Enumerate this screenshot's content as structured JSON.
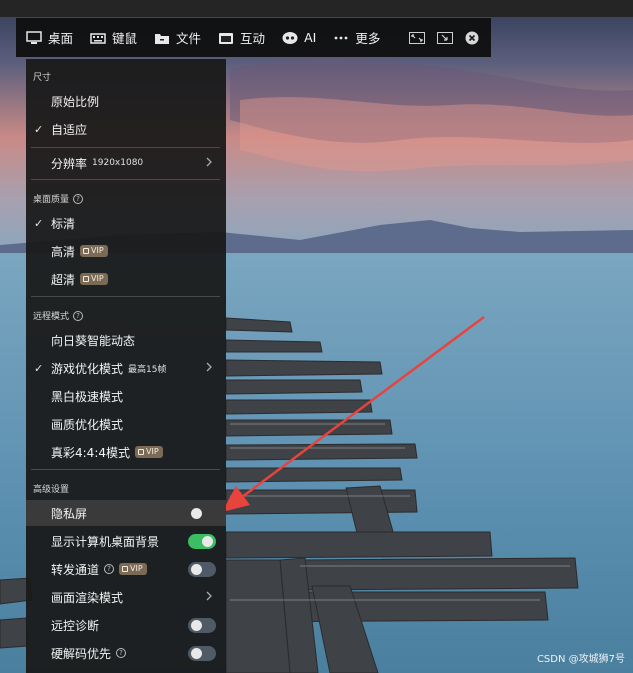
{
  "toolbar": {
    "desktop_label": "桌面",
    "keymouse_label": "键鼠",
    "file_label": "文件",
    "interact_label": "互动",
    "ai_label": "AI",
    "more_label": "更多"
  },
  "menu": {
    "size_section": "尺寸",
    "original_ratio": "原始比例",
    "adaptive": "自适应",
    "resolution_label": "分辨率",
    "resolution_value": "1920x1080",
    "quality_section": "桌面质量",
    "standard": "标清",
    "hd": "高清",
    "uhd": "超清",
    "vip": "VIP",
    "remote_section": "远程模式",
    "smart_dynamic": "向日葵智能动态",
    "game_mode": "游戏优化模式",
    "game_mode_sub": "最高15帧",
    "bw_mode": "黑白极速模式",
    "picture_mode": "画质优化模式",
    "true_color": "真彩4:4:4模式",
    "advanced_section": "高级设置",
    "privacy_screen": "隐私屏",
    "show_bg": "显示计算机桌面背景",
    "relay_channel": "转发通道",
    "render_mode": "画面渲染模式",
    "diagnose": "远控诊断",
    "hw_decode": "硬解码优先"
  },
  "toggles": {
    "privacy_screen": "off",
    "show_bg": "on",
    "relay_channel": "off",
    "diagnose": "off",
    "hw_decode": "off"
  },
  "watermark": "CSDN @攻城狮7号",
  "colors": {
    "toggle_on": "#3bbd63",
    "vip_badge": "#7b6a56",
    "arrow": "#e8443c"
  }
}
